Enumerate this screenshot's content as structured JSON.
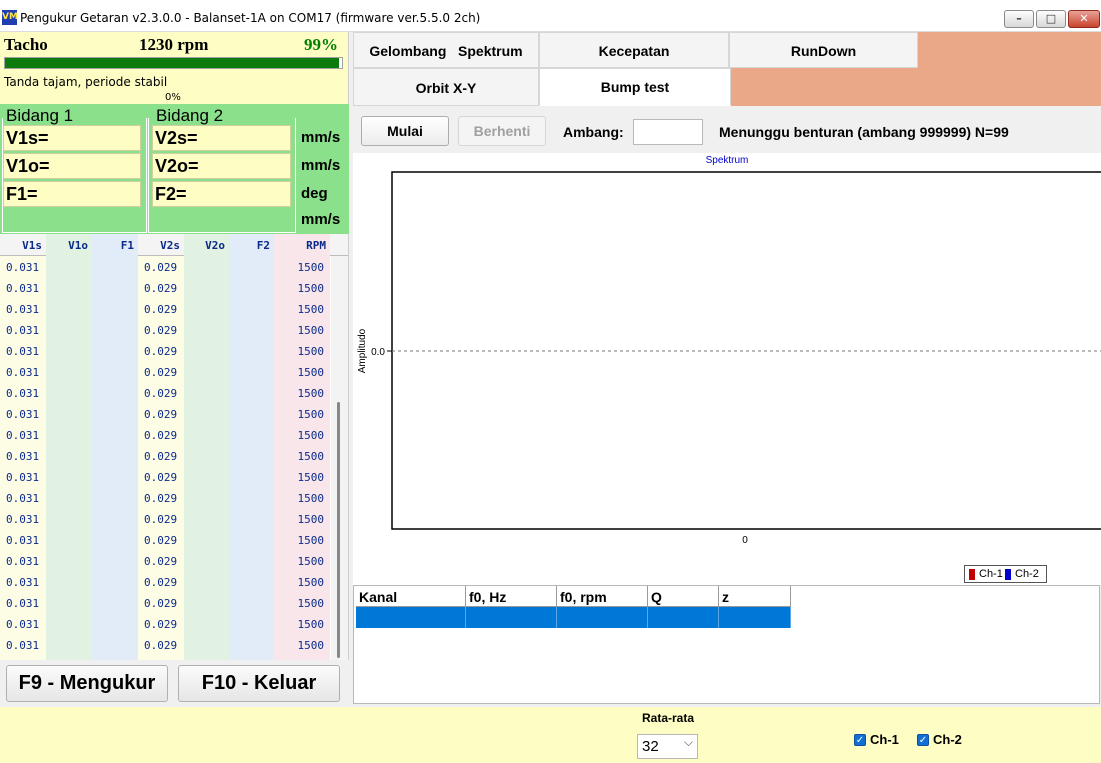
{
  "window": {
    "title": "Pengukur Getaran v2.3.0.0 - Balanset-1A on COM17 (firmware ver.5.5.0 2ch)",
    "icon_text": "VM",
    "buttons": {
      "minimize": "–",
      "maximize": "□",
      "close": "✕"
    }
  },
  "tacho": {
    "label": "Tacho",
    "rpm": "1230 rpm",
    "percent_text": "99%",
    "stability_level": 0.99,
    "status": "Tanda tajam, periode stabil",
    "zero_label": "0%",
    "colors": {
      "percent": "#008000",
      "bar": "#0d7a0d"
    }
  },
  "planes": {
    "plane1": {
      "title": "Bidang 1",
      "v_s": "V1s=",
      "v_o": "V1o=",
      "f": "F1="
    },
    "plane2": {
      "title": "Bidang 2",
      "v_s": "V2s=",
      "v_o": "V2o=",
      "f": "F2="
    },
    "units": [
      "mm/s",
      "mm/s",
      "deg",
      "mm/s"
    ]
  },
  "table": {
    "headers": [
      "V1s",
      "V1o",
      "F1",
      "V2s",
      "V2o",
      "F2",
      "RPM"
    ],
    "rows": [
      [
        "0.031",
        "",
        "",
        "0.029",
        "",
        "",
        "1500"
      ],
      [
        "0.031",
        "",
        "",
        "0.029",
        "",
        "",
        "1500"
      ],
      [
        "0.031",
        "",
        "",
        "0.029",
        "",
        "",
        "1500"
      ],
      [
        "0.031",
        "",
        "",
        "0.029",
        "",
        "",
        "1500"
      ],
      [
        "0.031",
        "",
        "",
        "0.029",
        "",
        "",
        "1500"
      ],
      [
        "0.031",
        "",
        "",
        "0.029",
        "",
        "",
        "1500"
      ],
      [
        "0.031",
        "",
        "",
        "0.029",
        "",
        "",
        "1500"
      ],
      [
        "0.031",
        "",
        "",
        "0.029",
        "",
        "",
        "1500"
      ],
      [
        "0.031",
        "",
        "",
        "0.029",
        "",
        "",
        "1500"
      ],
      [
        "0.031",
        "",
        "",
        "0.029",
        "",
        "",
        "1500"
      ],
      [
        "0.031",
        "",
        "",
        "0.029",
        "",
        "",
        "1500"
      ],
      [
        "0.031",
        "",
        "",
        "0.029",
        "",
        "",
        "1500"
      ],
      [
        "0.031",
        "",
        "",
        "0.029",
        "",
        "",
        "1500"
      ],
      [
        "0.031",
        "",
        "",
        "0.029",
        "",
        "",
        "1500"
      ],
      [
        "0.031",
        "",
        "",
        "0.029",
        "",
        "",
        "1500"
      ],
      [
        "0.031",
        "",
        "",
        "0.029",
        "",
        "",
        "1500"
      ],
      [
        "0.031",
        "",
        "",
        "0.029",
        "",
        "",
        "1500"
      ],
      [
        "0.031",
        "",
        "",
        "0.029",
        "",
        "",
        "1500"
      ],
      [
        "0.031",
        "",
        "",
        "0.029",
        "",
        "",
        "1500"
      ]
    ]
  },
  "actions": {
    "measure": "F9 - Mengukur",
    "exit": "F10 - Keluar"
  },
  "tabs": {
    "waveform": "Gelombang",
    "spectrum": "Spektrum",
    "velocity": "Kecepatan",
    "rundown": "RunDown",
    "orbit": "Orbit X-Y",
    "bump": "Bump test",
    "active": "bump"
  },
  "bump": {
    "start_label": "Mulai",
    "stop_label": "Berhenti",
    "threshold_label": "Ambang:",
    "threshold_value": "",
    "status": "Menunggu benturan (ambang 999999)  N=99"
  },
  "chart_data": {
    "type": "line",
    "title": "Spektrum",
    "xlabel": "",
    "ylabel": "Amplitudo",
    "x_ticks": [
      "0"
    ],
    "y_ticks": [
      "0.0"
    ],
    "series": [
      {
        "name": "Ch-1",
        "color": "#c00000",
        "values": []
      },
      {
        "name": "Ch-2",
        "color": "#0000cc",
        "values": []
      }
    ],
    "legend_position": "bottom-right",
    "grid": false
  },
  "results": {
    "headers": [
      "Kanal",
      "f0, Hz",
      "f0, rpm",
      "Q",
      "z"
    ],
    "rows": [
      [
        "",
        "",
        "",
        "",
        ""
      ]
    ]
  },
  "footer": {
    "average_label": "Rata-rata",
    "average_value": "32",
    "ch1_label": "Ch-1",
    "ch2_label": "Ch-2",
    "ch1_checked": true,
    "ch2_checked": true
  }
}
